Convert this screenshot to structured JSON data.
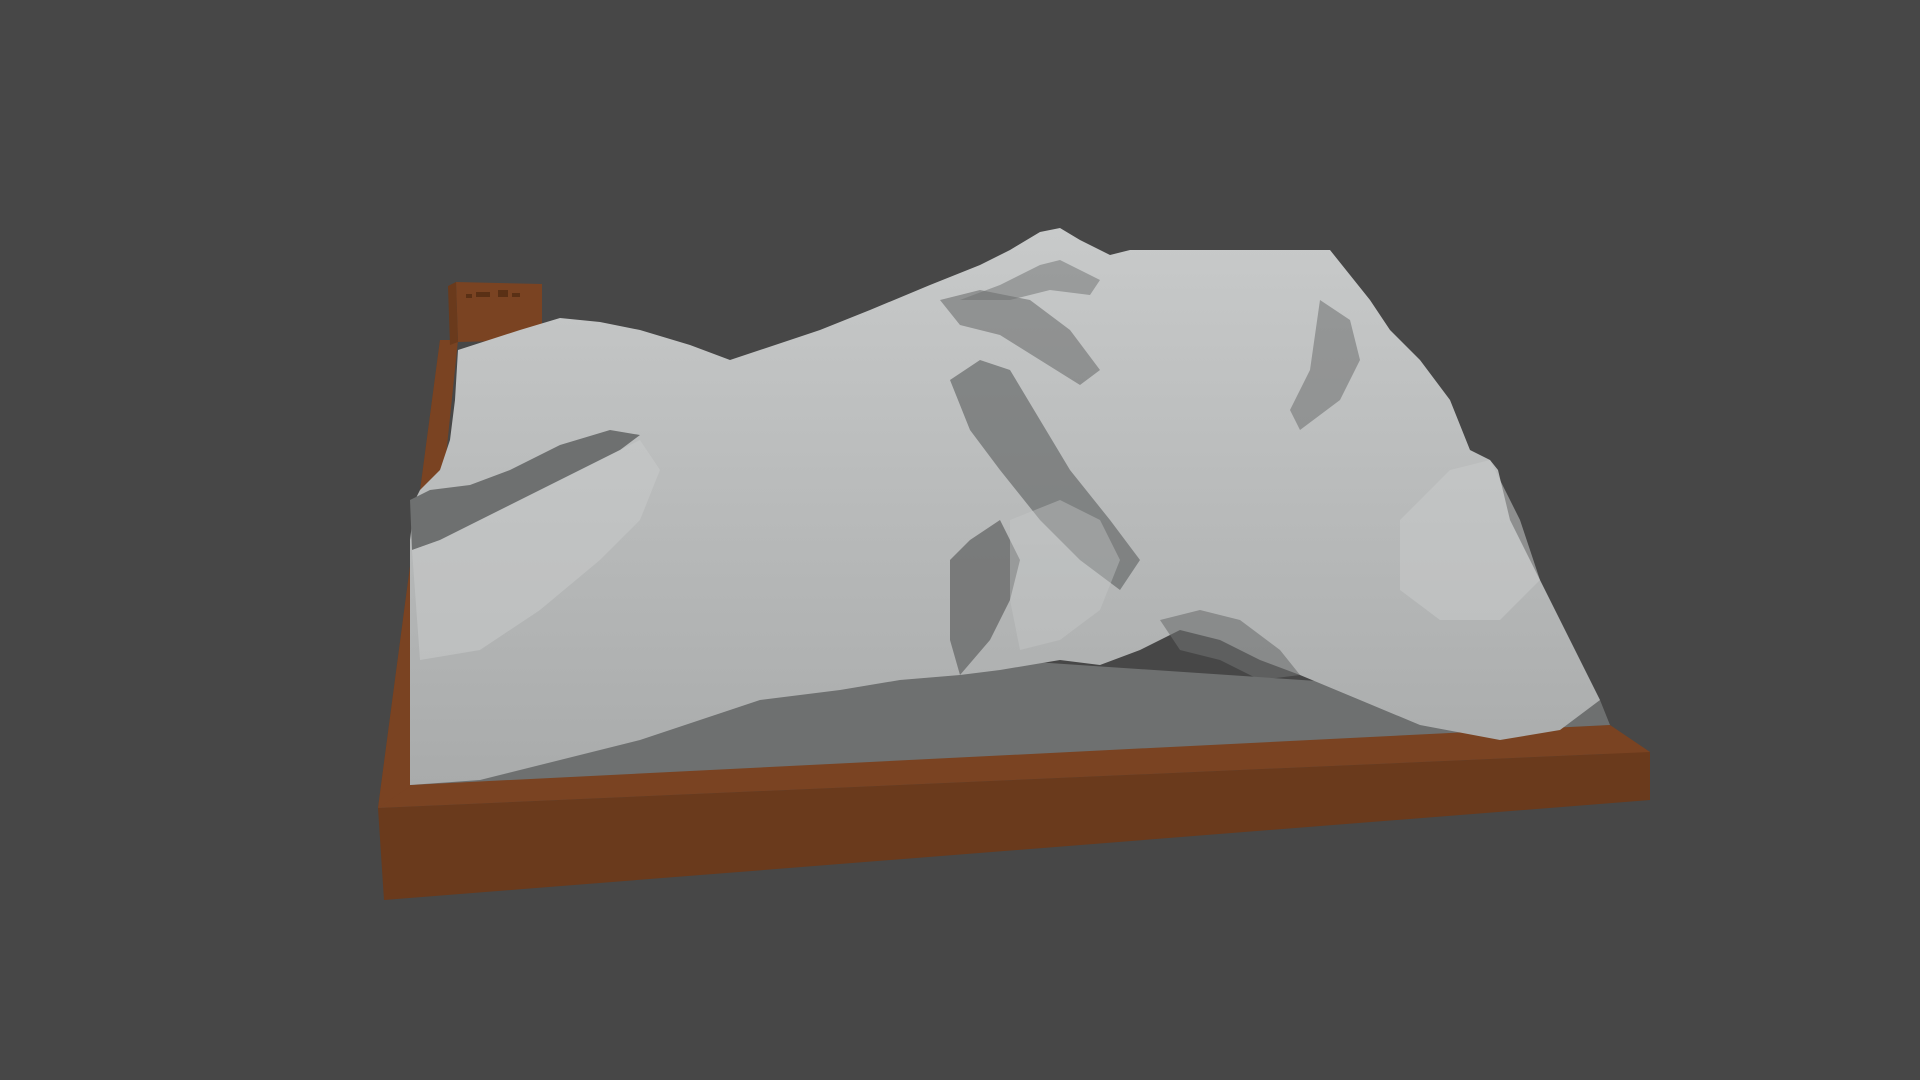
{
  "viewport": {
    "background_color": "#474747",
    "shading": "solid"
  },
  "model": {
    "type": "terrain-relief-model",
    "terrain_color": "#a9abab",
    "terrain_shadow_color": "#6e7070",
    "terrain_highlight_color": "#c8caca",
    "base_color": "#7a4322",
    "base_side_color": "#6a3a1c",
    "plate_engraving_color": "#5a3015"
  }
}
